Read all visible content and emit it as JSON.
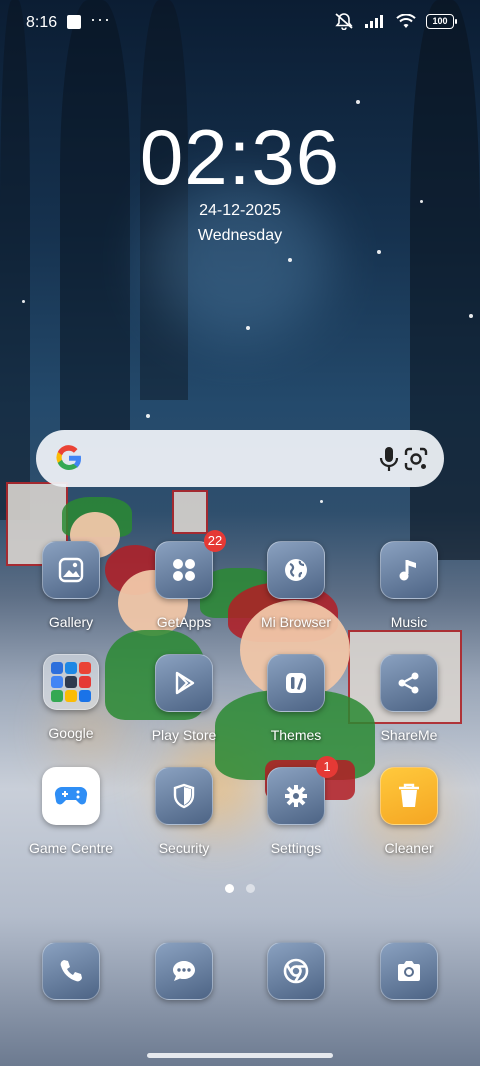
{
  "status_bar": {
    "time": "8:16",
    "more": "···",
    "battery": "100",
    "icons": [
      "notification-square-icon",
      "silent-icon",
      "signal-icon",
      "wifi-icon",
      "battery-icon"
    ]
  },
  "clock": {
    "time": "02:36",
    "date": "24-12-2025",
    "weekday": "Wednesday"
  },
  "search_bar": {
    "icons": [
      "google-logo-icon",
      "microphone-icon",
      "google-lens-icon"
    ]
  },
  "apps": [
    {
      "label": "Gallery",
      "icon": "gallery-icon"
    },
    {
      "label": "GetApps",
      "icon": "getapps-icon",
      "badge": "22"
    },
    {
      "label": "Mi Browser",
      "icon": "globe-icon"
    },
    {
      "label": "Music",
      "icon": "music-note-icon"
    },
    {
      "label": "Google",
      "icon": "folder-icon"
    },
    {
      "label": "Play Store",
      "icon": "play-store-icon"
    },
    {
      "label": "Themes",
      "icon": "themes-icon"
    },
    {
      "label": "ShareMe",
      "icon": "share-icon"
    },
    {
      "label": "Game Centre",
      "icon": "gamepad-icon"
    },
    {
      "label": "Security",
      "icon": "shield-icon"
    },
    {
      "label": "Settings",
      "icon": "gear-icon",
      "badge": "1"
    },
    {
      "label": "Cleaner",
      "icon": "trash-icon"
    }
  ],
  "dock": [
    {
      "icon": "phone-icon"
    },
    {
      "icon": "messages-icon"
    },
    {
      "icon": "chrome-icon"
    },
    {
      "icon": "camera-icon"
    }
  ],
  "page_indicator": {
    "pages": 2,
    "current": 1
  },
  "colors": {
    "badge": "#e53935",
    "icon_tile": "#6a82a4",
    "cleaner_accent": "#f5a623",
    "game_accent": "#2f8ef5"
  }
}
